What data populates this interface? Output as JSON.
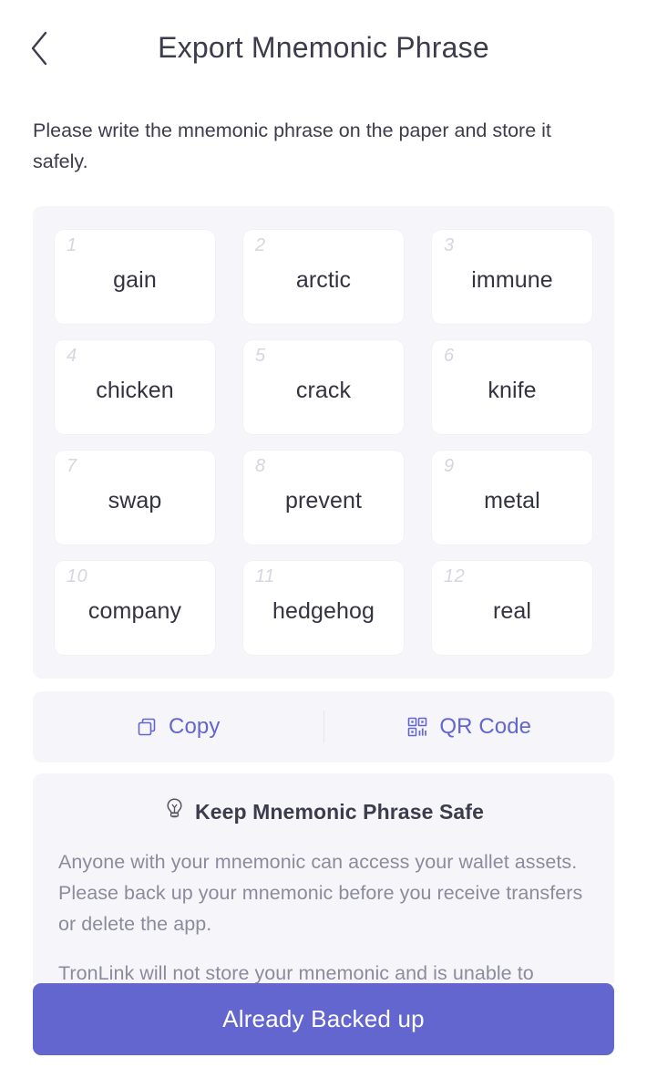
{
  "header": {
    "back_icon": "chevron-left-icon",
    "title": "Export Mnemonic Phrase"
  },
  "intro": {
    "text": "Please write the mnemonic phrase on the paper and store it safely."
  },
  "mnemonic": {
    "word_count": 12,
    "words": [
      {
        "index": "1",
        "word": "gain"
      },
      {
        "index": "2",
        "word": "arctic"
      },
      {
        "index": "3",
        "word": "immune"
      },
      {
        "index": "4",
        "word": "chicken"
      },
      {
        "index": "5",
        "word": "crack"
      },
      {
        "index": "6",
        "word": "knife"
      },
      {
        "index": "7",
        "word": "swap"
      },
      {
        "index": "8",
        "word": "prevent"
      },
      {
        "index": "9",
        "word": "metal"
      },
      {
        "index": "10",
        "word": "company"
      },
      {
        "index": "11",
        "word": "hedgehog"
      },
      {
        "index": "12",
        "word": "real"
      }
    ]
  },
  "actions": {
    "copy": {
      "label": "Copy",
      "icon": "copy-icon"
    },
    "qr": {
      "label": "QR Code",
      "icon": "qr-code-icon"
    }
  },
  "warning": {
    "icon": "lightbulb-icon",
    "title": "Keep Mnemonic Phrase Safe",
    "paragraph_1": "Anyone with your mnemonic can access your wallet assets. Please back up your mnemonic before you receive transfers or delete the app.",
    "paragraph_2": "TronLink will not store your mnemonic and is unable to recover your wallet once it is lost."
  },
  "cta": {
    "label": "Already Backed up"
  },
  "colors": {
    "accent": "#6366cf",
    "panel_bg": "#f6f6fa",
    "card_bg": "#ffffff",
    "text_primary": "#3c3c4c",
    "text_muted": "#8b8b9c",
    "index_gray": "#d6d6de"
  }
}
